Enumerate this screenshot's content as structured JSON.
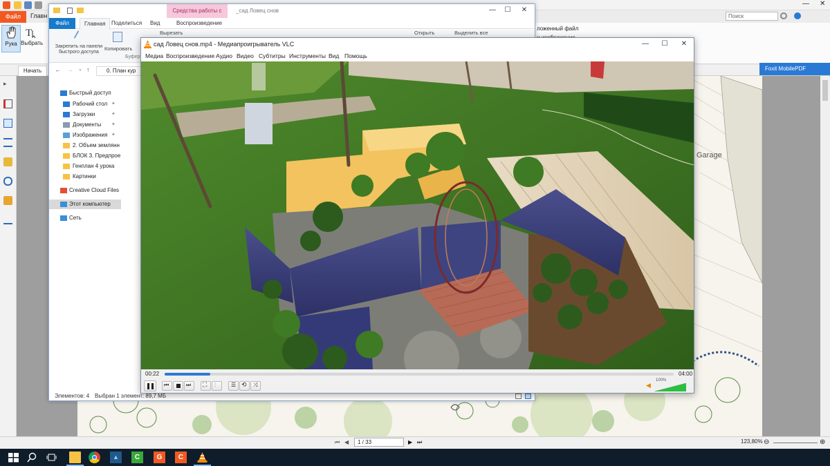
{
  "foxit": {
    "file_tab": "Файл",
    "home_tab": "Главн",
    "search_placeholder": "Поиск",
    "tools": [
      {
        "label": "Рука",
        "icon": "hand-icon"
      },
      {
        "label": "Выбрать",
        "icon": "select-text-icon"
      }
    ],
    "start_tab": "Начать",
    "right_fragment_1": "ложенный файл",
    "right_fragment_2": "и изображение",
    "mobile_pdf": "Foxit MobilePDF",
    "page_indicator": "1 / 33",
    "zoom": "123,80%",
    "map_label": "Garage",
    "colors": {
      "accent": "#f05a22",
      "mobile": "#2a7ad5"
    }
  },
  "explorer": {
    "title": "_сад Ловец снов",
    "context_tab": "Средства работы с видео",
    "file_tab": "Файл",
    "tabs": [
      "Главная",
      "Поделиться",
      "Вид",
      "Воспроизведение"
    ],
    "ribbon": {
      "pin": "Закрепить на панели быстрого доступа",
      "copy": "Копировать",
      "cut": "Вырезать",
      "open": "Открыть",
      "select_all": "Выделить все",
      "clipboard_group": "Буфер обме"
    },
    "address": "0. План кур",
    "nav": [
      {
        "label": "Быстрый доступ",
        "icon": "star-icon",
        "pinned": false,
        "indent": false
      },
      {
        "label": "Рабочий стол",
        "icon": "desktop-icon",
        "pinned": true,
        "indent": true
      },
      {
        "label": "Загрузки",
        "icon": "download-icon",
        "pinned": true,
        "indent": true
      },
      {
        "label": "Документы",
        "icon": "documents-icon",
        "pinned": true,
        "indent": true
      },
      {
        "label": "Изображения",
        "icon": "pictures-icon",
        "pinned": true,
        "indent": true
      },
      {
        "label": "2. Объем землянн",
        "icon": "folder-icon",
        "pinned": false,
        "indent": true
      },
      {
        "label": "БЛОК 3. Предпрое",
        "icon": "folder-icon",
        "pinned": false,
        "indent": true
      },
      {
        "label": "Генплан 4 урока",
        "icon": "folder-icon",
        "pinned": false,
        "indent": true
      },
      {
        "label": "Картинки",
        "icon": "folder-icon",
        "pinned": false,
        "indent": true
      },
      {
        "label": "Creative Cloud Files",
        "icon": "creative-cloud-icon",
        "pinned": false,
        "indent": false
      },
      {
        "label": "Этот компьютер",
        "icon": "computer-icon",
        "pinned": false,
        "indent": false,
        "selected": true
      },
      {
        "label": "Сеть",
        "icon": "network-icon",
        "pinned": false,
        "indent": false
      }
    ],
    "status": {
      "items": "Элементов: 4",
      "selected": "Выбран 1 элемент: 89,7 МБ"
    }
  },
  "vlc": {
    "title": "сад Ловец снов.mp4 - Медиапроигрыватель VLC",
    "menu": [
      "Медиа",
      "Воспроизведение",
      "Аудио",
      "Видео",
      "Субтитры",
      "Инструменты",
      "Вид",
      "Помощь"
    ],
    "time_current": "00:22",
    "time_total": "04:00",
    "progress": 0.09,
    "volume_label": "100%",
    "volume": 1.0,
    "controls": [
      "pause-icon",
      "previous-icon",
      "stop-icon",
      "next-icon",
      "fullscreen-icon",
      "extended-settings-icon",
      "playlist-icon",
      "loop-icon",
      "shuffle-icon"
    ]
  },
  "taskbar": {
    "apps": [
      "start-icon",
      "search-icon",
      "task-view-icon",
      "file-explorer-icon",
      "chrome-icon",
      "photoshop-icon",
      "camtasia-icon",
      "foxit-icon",
      "foxit-reader-icon",
      "vlc-icon"
    ]
  }
}
